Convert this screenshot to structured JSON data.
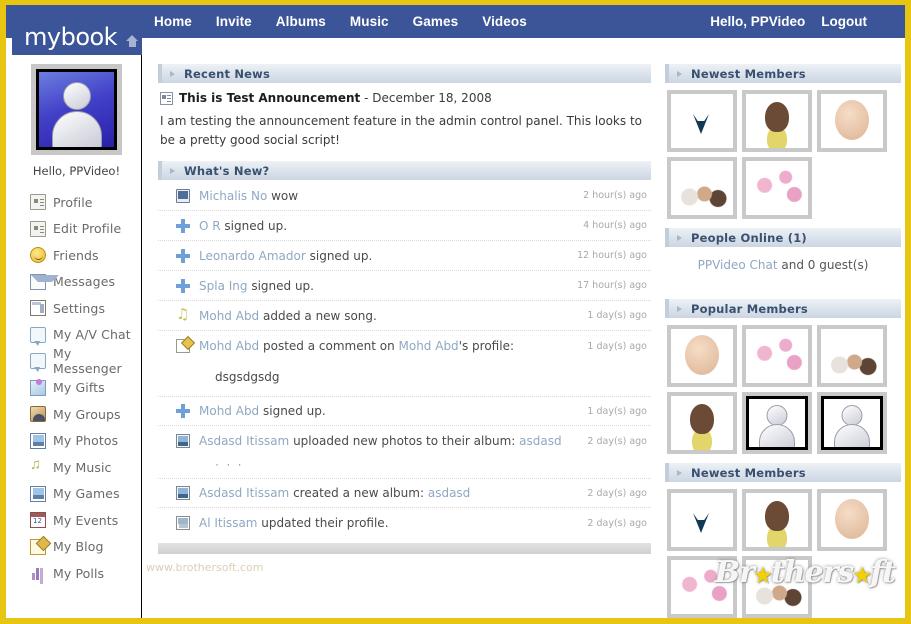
{
  "brand": {
    "logo": "mybook",
    "home_icon": "home-icon"
  },
  "nav": {
    "items": [
      {
        "label": "Home"
      },
      {
        "label": "Invite"
      },
      {
        "label": "Albums"
      },
      {
        "label": "Music"
      },
      {
        "label": "Games"
      },
      {
        "label": "Videos"
      }
    ],
    "greeting": "Hello, PPVideo",
    "logout": "Logout"
  },
  "sidebar": {
    "hello": "Hello, PPVideo!",
    "items": [
      {
        "label": "Profile",
        "icon": "id-card-icon"
      },
      {
        "label": "Edit Profile",
        "icon": "edit-profile-icon"
      },
      {
        "label": "Friends",
        "icon": "smiley-icon"
      },
      {
        "label": "Messages",
        "icon": "envelope-icon"
      },
      {
        "label": "Settings",
        "icon": "window-settings-icon"
      },
      {
        "label": "My A/V Chat",
        "icon": "chat-bubble-icon"
      },
      {
        "label": "My Messenger",
        "icon": "chat-bubble-icon"
      },
      {
        "label": "My Gifts",
        "icon": "gift-icon"
      },
      {
        "label": "My Groups",
        "icon": "group-icon"
      },
      {
        "label": "My Photos",
        "icon": "photo-icon"
      },
      {
        "label": "My Music",
        "icon": "music-note-icon"
      },
      {
        "label": "My Games",
        "icon": "game-screen-icon"
      },
      {
        "label": "My Events",
        "icon": "calendar-icon"
      },
      {
        "label": "My Blog",
        "icon": "blog-pencil-icon"
      },
      {
        "label": "My Polls",
        "icon": "bar-chart-icon"
      }
    ]
  },
  "main": {
    "recent_news": {
      "panel_title": "Recent News",
      "announcement_title": "This is Test Announcement",
      "announcement_date": "- December 18, 2008",
      "announcement_body": "I am testing the announcement feature in the admin control panel. This looks to be a pretty good social script!"
    },
    "whats_new": {
      "panel_title": "What's New?",
      "items": [
        {
          "icon": "monitor-icon",
          "user": "Michalis No",
          "action": " wow",
          "link": "",
          "time": "2 hour(s) ago"
        },
        {
          "icon": "plus-icon",
          "user": "O R",
          "action": " signed up.",
          "link": "",
          "time": "4 hour(s) ago"
        },
        {
          "icon": "plus-icon",
          "user": "Leonardo Amador",
          "action": " signed up.",
          "link": "",
          "time": "12 hour(s) ago"
        },
        {
          "icon": "plus-icon",
          "user": "Spla Ing",
          "action": " signed up.",
          "link": "",
          "time": "17 hour(s) ago"
        },
        {
          "icon": "music-note-icon",
          "user": "Mohd Abd",
          "action": " added a new song.",
          "link": "",
          "time": "1 day(s) ago"
        },
        {
          "icon": "pencil-icon",
          "user": "Mohd Abd",
          "action": " posted a comment on ",
          "user2": "Mohd Abd",
          "action2": "'s profile:",
          "link": "",
          "time": "1 day(s) ago",
          "comment": "dsgsdgsdg"
        },
        {
          "icon": "plus-icon",
          "user": "Mohd Abd",
          "action": " signed up.",
          "link": "",
          "time": "1 day(s) ago"
        },
        {
          "icon": "album-icon",
          "user": "Asdasd Itissam",
          "action": " uploaded new photos to their album: ",
          "link": "asdasd",
          "time": "2 day(s) ago",
          "dots": "· · ·"
        },
        {
          "icon": "album-icon",
          "user": "Asdasd Itissam",
          "action": " created a new album: ",
          "link": "asdasd",
          "time": "2 day(s) ago"
        },
        {
          "icon": "profile-icon",
          "user": "Al Itissam",
          "action": " updated their profile.",
          "link": "",
          "time": "2 day(s) ago"
        }
      ]
    }
  },
  "right": {
    "newest_members_top": {
      "panel_title": "Newest Members",
      "thumbs": [
        "whale",
        "girl",
        "baby",
        "group",
        "flower"
      ]
    },
    "people_online": {
      "panel_title": "People Online (1)",
      "user": "PPVideo Chat",
      "suffix": " and 0 guest(s)"
    },
    "popular_members": {
      "panel_title": "Popular Members",
      "thumbs": [
        "baby",
        "flower",
        "group",
        "girl",
        "avatar",
        "avatar"
      ]
    },
    "newest_members_bottom": {
      "panel_title": "Newest Members",
      "thumbs": [
        "whale",
        "girl",
        "baby",
        "flower",
        "group"
      ]
    }
  },
  "watermark": {
    "text_a": "Br",
    "star1": "★",
    "text_b": "thers",
    "star2": "★",
    "text_c": "ft",
    "site": "www.brothersoft.com"
  },
  "colors": {
    "nav_blue": "#3b5598",
    "border_yellow": "#e8c511",
    "panel_head": "#dbe3ec",
    "heading_text": "#39506f",
    "link_blue": "#8fa8c2"
  }
}
